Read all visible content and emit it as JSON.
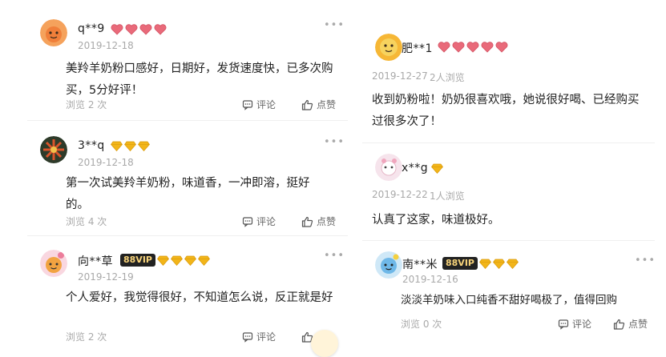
{
  "left_column": {
    "reviews": [
      {
        "username": "q**9",
        "date": "2019-12-18",
        "text": "美羚羊奶粉口感好，日期好，发货速度快，已多次购买，5分好评！",
        "views": "浏览 2 次",
        "comment_label": "评论",
        "like_label": "点赞",
        "badge_count": 4,
        "badge_type": "heart"
      },
      {
        "username": "3**q",
        "date": "2019-12-18",
        "text": "第一次试美羚羊奶粉，味道香，一冲即溶，挺好的。",
        "views": "浏览 4 次",
        "comment_label": "评论",
        "like_label": "点赞",
        "badge_count": 3,
        "badge_type": "diamond"
      },
      {
        "username": "向**草",
        "vip": "88VIP",
        "date": "2019-12-19",
        "text": "个人爱好，我觉得很好，不知道怎么说，反正就是好",
        "views": "浏览 2 次",
        "comment_label": "评论",
        "like_label": "点",
        "badge_count": 4,
        "badge_type": "diamond"
      }
    ]
  },
  "right_column": {
    "reviews": [
      {
        "username": "肥**1",
        "date": "2019-12-27",
        "views_inline": "2人浏览",
        "text": "收到奶粉啦！奶奶很喜欢哦，她说很好喝、已经购买过很多次了！",
        "badge_count": 5,
        "badge_type": "heart"
      },
      {
        "username": "x**g",
        "date": "2019-12-22",
        "views_inline": "1人浏览",
        "text": "认真了这家，味道极好。",
        "badge_count": 1,
        "badge_type": "diamond"
      },
      {
        "username": "南**米",
        "vip": "88VIP",
        "date": "2019-12-16",
        "text": "淡淡羊奶味入口纯香不甜好喝极了，值得回购",
        "views": "浏览 0 次",
        "comment_label": "评论",
        "like_label": "点赞",
        "badge_count": 3,
        "badge_type": "diamond"
      }
    ]
  },
  "colors": {
    "heart_badge": "#e96a7a",
    "diamond_badge": "#f2b519",
    "vip_bg": "#222222",
    "vip_text": "#f7d37a"
  },
  "icons": [
    "more-dots-icon",
    "comment-icon",
    "like-icon",
    "heart-badge-icon",
    "diamond-badge-icon"
  ]
}
